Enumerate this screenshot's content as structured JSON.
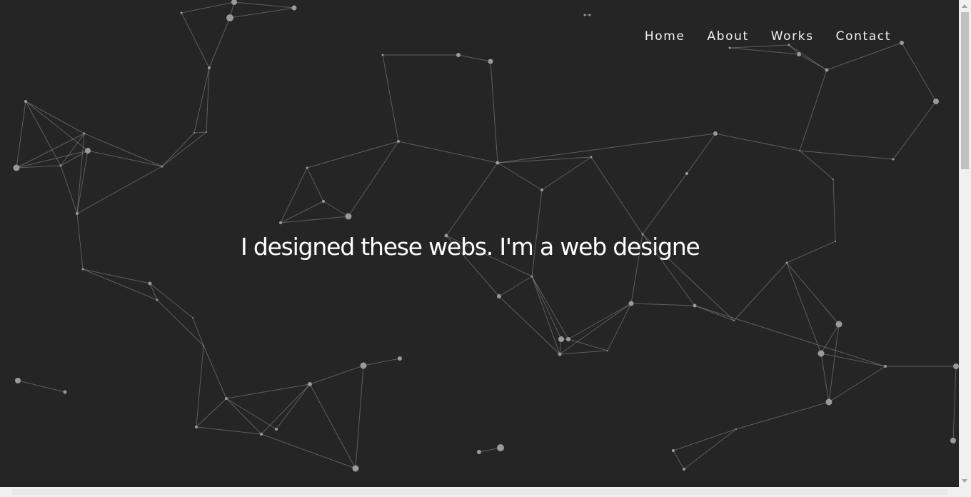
{
  "nav": {
    "items": [
      {
        "label": "Home"
      },
      {
        "label": "About"
      },
      {
        "label": "Works"
      },
      {
        "label": "Contact"
      }
    ]
  },
  "hero": {
    "text": "I designed these webs. I'm a web designe"
  },
  "colors": {
    "background": "#252525",
    "text": "#ffffff",
    "particle": "#9a9a9a",
    "line": "#8c8c8c"
  }
}
